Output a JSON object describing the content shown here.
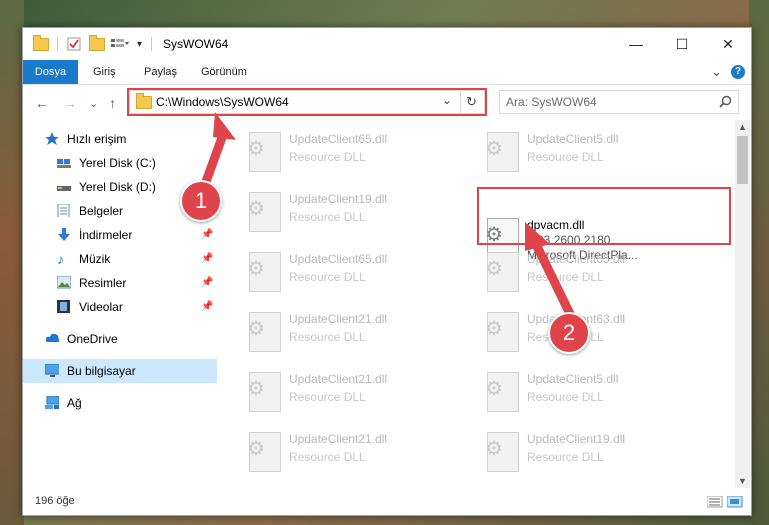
{
  "window": {
    "title": "SysWOW64",
    "min": "—",
    "max": "☐",
    "close": "✕"
  },
  "ribbon": {
    "tabs": [
      {
        "label": "Dosya"
      },
      {
        "label": "Giriş"
      },
      {
        "label": "Paylaş"
      },
      {
        "label": "Görünüm"
      }
    ],
    "expand": "⌄",
    "help": "?"
  },
  "address": {
    "path": "C:\\Windows\\SysWOW64",
    "dropdown": "⌄",
    "refresh": "↻"
  },
  "search": {
    "placeholder": "Ara: SysWOW64",
    "icon": "search-icon"
  },
  "nav": {
    "back": "←",
    "forward": "→",
    "recent": "⌄",
    "up": "↑",
    "items": [
      {
        "label": "Hızlı erişim"
      },
      {
        "label": "Yerel Disk (C:)"
      },
      {
        "label": "Yerel Disk (D:)"
      },
      {
        "label": "Belgeler"
      },
      {
        "label": "İndirmeler"
      },
      {
        "label": "Müzik"
      },
      {
        "label": "Resimler"
      },
      {
        "label": "Videolar"
      },
      {
        "label": "OneDrive"
      },
      {
        "label": "Bu bilgisayar"
      },
      {
        "label": "Ağ"
      }
    ]
  },
  "files": [
    {
      "name": "UpdateClient65.dll",
      "type": "Resource DLL"
    },
    {
      "name": "UpdateClient5.dll",
      "type": "Resource DLL"
    },
    {
      "name": "UpdateClient19.dll",
      "type": "Resource DLL"
    },
    {
      "name": "dpvacm.dll",
      "version": "5.03.2600.2180",
      "company": "Microsoft DirectPla..."
    },
    {
      "name": "UpdateClient65.dll",
      "type": "Resource DLL"
    },
    {
      "name": "UpdateClient65.dll",
      "type": "Resource DLL"
    },
    {
      "name": "UpdateClient21.dll",
      "type": "Resource DLL"
    },
    {
      "name": "UpdateClient63.dll",
      "type": "Resource DLL"
    },
    {
      "name": "UpdateClient21.dll",
      "type": "Resource DLL"
    },
    {
      "name": "UpdateClient5.dll",
      "type": "Resource DLL"
    },
    {
      "name": "UpdateClient21.dll",
      "type": "Resource DLL"
    },
    {
      "name": "UpdateClient19.dll",
      "type": "Resource DLL"
    }
  ],
  "status": {
    "count": "196 öğe"
  },
  "badges": {
    "one": "1",
    "two": "2"
  }
}
